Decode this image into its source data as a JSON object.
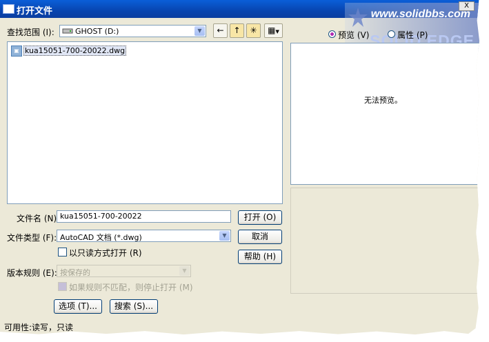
{
  "window": {
    "title": "打开文件",
    "close_label": "X"
  },
  "watermark": {
    "url": "www.solidbbs.com",
    "brand": "SOLID EDGE"
  },
  "lookin": {
    "label": "查找范围 (I):",
    "drive_icon": "drive-icon",
    "value": "GHOST (D:)"
  },
  "toolbar": {
    "back_icon": "←",
    "up_icon": "↑",
    "newfolder_icon": "✳",
    "views_icon": "▦"
  },
  "files": [
    {
      "name": "kua15051-700-20022.dwg",
      "icon": "dwg-file-icon"
    }
  ],
  "preview_options": {
    "preview_label": "预览 (V)",
    "properties_label": "属性 (P)"
  },
  "preview": {
    "message": "无法预览。"
  },
  "filename": {
    "label": "文件名 (N):",
    "value": "kua15051-700-20022"
  },
  "filetype": {
    "label": "文件类型 (F):",
    "value": "AutoCAD 文档 (*.dwg)"
  },
  "readonly": {
    "label": "以只读方式打开 (R)"
  },
  "version": {
    "label": "版本规则 (E):",
    "value": "按保存的"
  },
  "stop_if_mismatch": {
    "label": "如果规则不匹配，则停止打开 (M)"
  },
  "buttons": {
    "open": "打开 (O)",
    "cancel": "取消",
    "help": "帮助 (H)",
    "options": "选项 (T)...",
    "search": "搜索 (S)..."
  },
  "status": {
    "text": "可用性:读写，只读"
  },
  "colors": {
    "titlebar": "#0845b0",
    "dialog_bg": "#ece9d8",
    "accent": "#7f9db9"
  }
}
